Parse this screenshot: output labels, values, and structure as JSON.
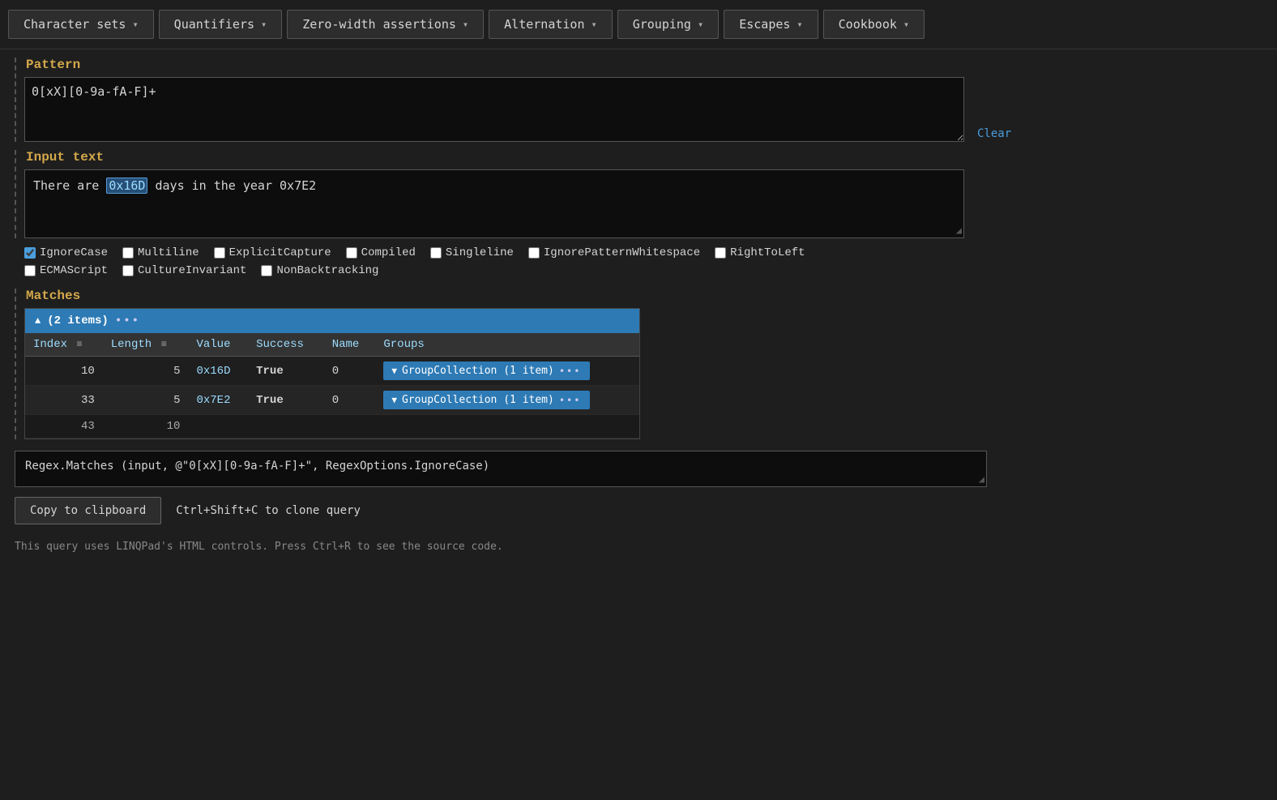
{
  "nav": {
    "items": [
      {
        "label": "Character sets",
        "id": "character-sets"
      },
      {
        "label": "Quantifiers",
        "id": "quantifiers"
      },
      {
        "label": "Zero-width assertions",
        "id": "zero-width"
      },
      {
        "label": "Alternation",
        "id": "alternation"
      },
      {
        "label": "Grouping",
        "id": "grouping"
      },
      {
        "label": "Escapes",
        "id": "escapes"
      },
      {
        "label": "Cookbook",
        "id": "cookbook"
      }
    ]
  },
  "pattern": {
    "label": "Pattern",
    "value": "0[xX][0-9a-fA-F]+",
    "clear_label": "Clear"
  },
  "input_text": {
    "label": "Input text",
    "prefix": "There are ",
    "highlight": "0x16D",
    "suffix": " days in the year 0x7E2"
  },
  "checkboxes": {
    "row1": [
      {
        "id": "ignorecase",
        "label": "IgnoreCase",
        "checked": true
      },
      {
        "id": "multiline",
        "label": "Multiline",
        "checked": false
      },
      {
        "id": "explicitcapture",
        "label": "ExplicitCapture",
        "checked": false
      },
      {
        "id": "compiled",
        "label": "Compiled",
        "checked": false
      },
      {
        "id": "singleline",
        "label": "Singleline",
        "checked": false
      },
      {
        "id": "ignorepatternwhitespace",
        "label": "IgnorePatternWhitespace",
        "checked": false
      },
      {
        "id": "righttoleft",
        "label": "RightToLeft",
        "checked": false
      }
    ],
    "row2": [
      {
        "id": "ecmascript",
        "label": "ECMAScript",
        "checked": false
      },
      {
        "id": "cultureinvariant",
        "label": "CultureInvariant",
        "checked": false
      },
      {
        "id": "nonbacktracking",
        "label": "NonBacktracking",
        "checked": false
      }
    ]
  },
  "matches": {
    "label": "Matches",
    "header": "(2 items)",
    "columns": [
      "Index",
      "Length",
      "Value",
      "Success",
      "Name",
      "Groups"
    ],
    "rows": [
      {
        "index": "10",
        "length": "5",
        "value": "0x16D",
        "success": "True",
        "name": "0",
        "group": "GroupCollection (1 item)"
      },
      {
        "index": "33",
        "length": "5",
        "value": "0x7E2",
        "success": "True",
        "name": "0",
        "group": "GroupCollection (1 item)"
      },
      {
        "index": "43",
        "length": "10",
        "value": "",
        "success": "",
        "name": "",
        "group": ""
      }
    ]
  },
  "code_output": {
    "value": "Regex.Matches (input, @\"0[xX][0-9a-fA-F]+\", RegexOptions.IgnoreCase)"
  },
  "copy_section": {
    "button_label": "Copy to clipboard",
    "shortcut": "Ctrl+Shift+C to clone query"
  },
  "footer": {
    "text": "This query uses LINQPad's HTML controls. Press Ctrl+R to see the source code."
  }
}
